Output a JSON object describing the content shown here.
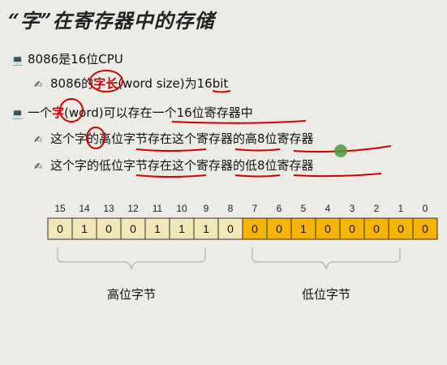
{
  "title": "“字”在寄存器中的存储",
  "bullets": {
    "b1": "8086是16位CPU",
    "b1a_pre": "8086的",
    "b1a_hl": "字长",
    "b1a_post": "(word size)为16bit",
    "b2_pre": "一个",
    "b2_hl": "字",
    "b2_post": "(word)可以存在一个16位寄存器中",
    "b2a": "这个字的高位字节存在这个寄存器的高8位寄存器",
    "b2b": "这个字的低位字节存在这个寄存器的低8位寄存器"
  },
  "register": {
    "bit_numbers": [
      "15",
      "14",
      "13",
      "12",
      "11",
      "10",
      "9",
      "8",
      "7",
      "6",
      "5",
      "4",
      "3",
      "2",
      "1",
      "0"
    ],
    "bit_values": [
      "0",
      "1",
      "0",
      "0",
      "1",
      "1",
      "1",
      "0",
      "0",
      "0",
      "1",
      "0",
      "0",
      "0",
      "0",
      "0"
    ],
    "high_color": "#f2e7b9",
    "low_color": "#f5b400",
    "high_label": "高位字节",
    "low_label": "低位字节"
  },
  "colors": {
    "accent_red": "#c00000",
    "pointer_green": "#4c9a3c"
  }
}
